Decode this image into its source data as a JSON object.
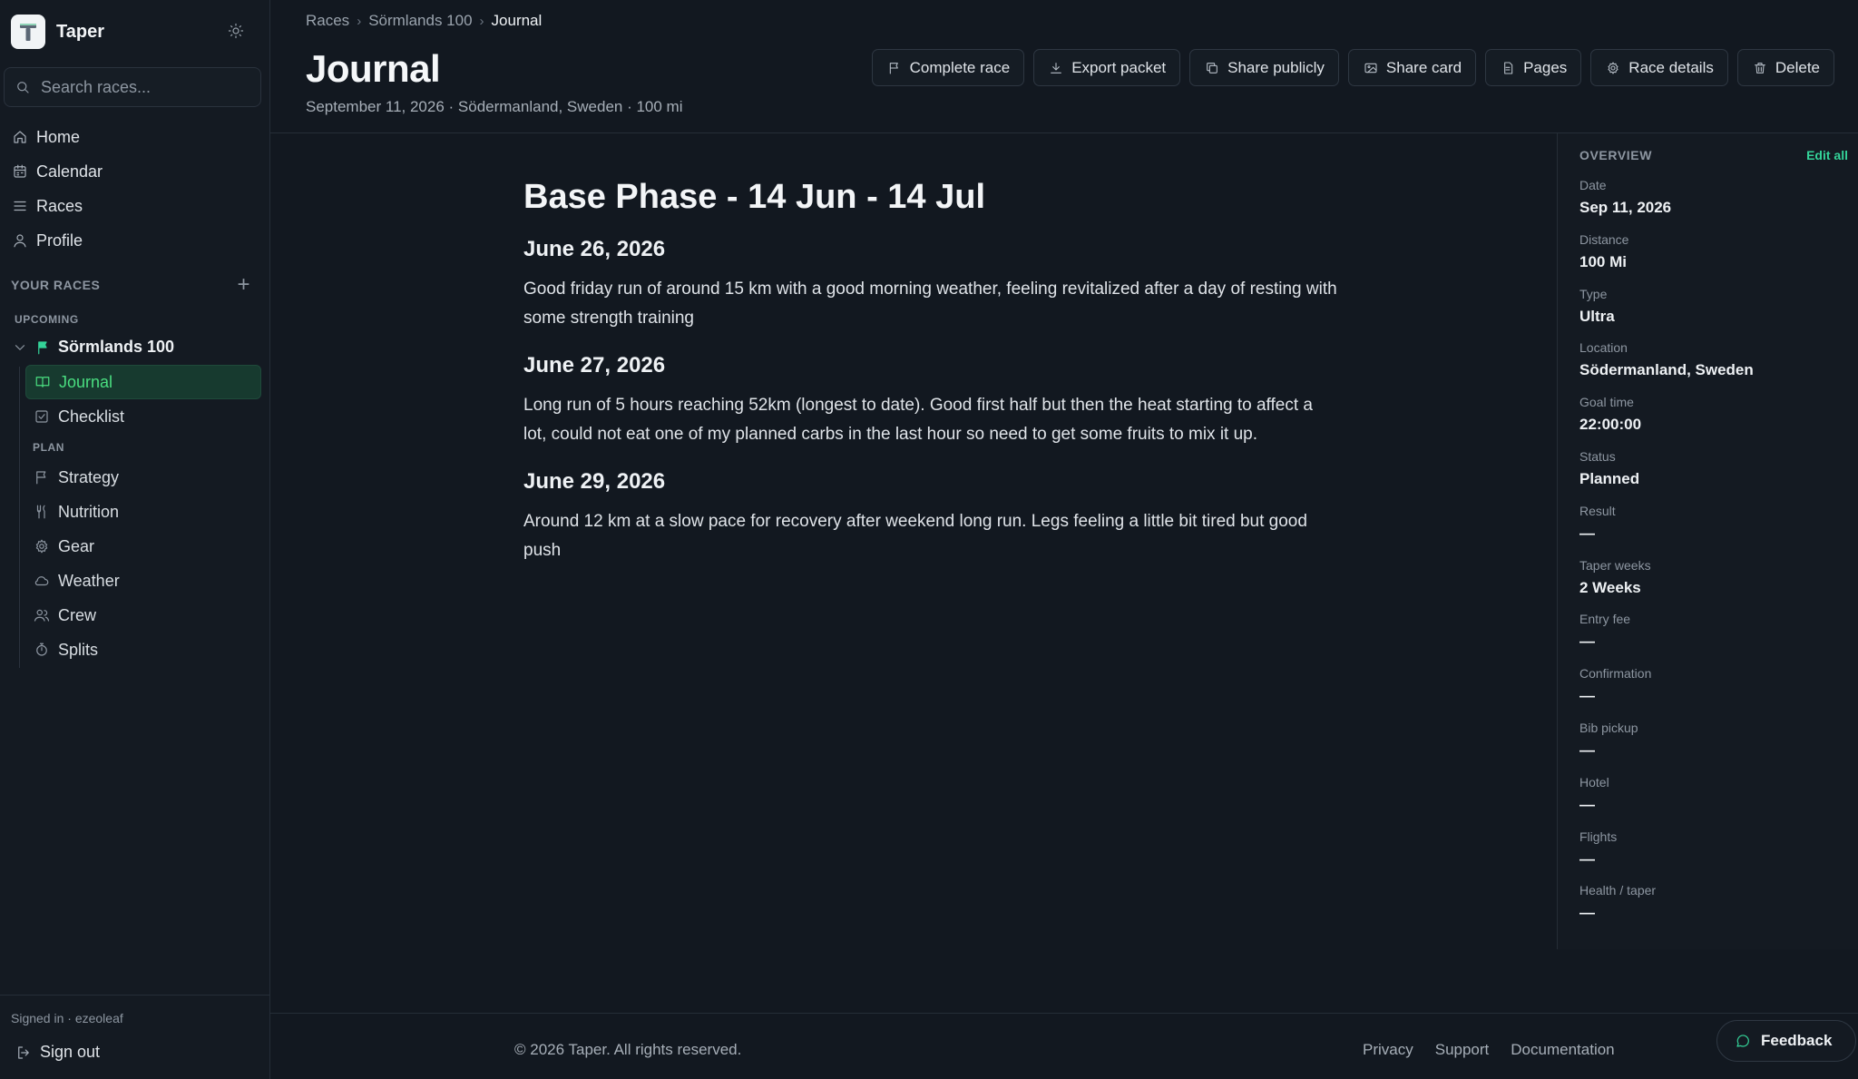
{
  "app": {
    "name": "Taper"
  },
  "sidebar": {
    "search_placeholder": "Search races...",
    "nav": [
      {
        "label": "Home",
        "icon": "home-icon"
      },
      {
        "label": "Calendar",
        "icon": "calendar-icon"
      },
      {
        "label": "Races",
        "icon": "list-icon"
      },
      {
        "label": "Profile",
        "icon": "user-icon"
      }
    ],
    "your_races_label": "YOUR RACES",
    "upcoming_label": "UPCOMING",
    "race_name": "Sörmlands 100",
    "race_pages": [
      {
        "label": "Journal",
        "icon": "book-icon",
        "active": true
      },
      {
        "label": "Checklist",
        "icon": "checkbox-icon"
      }
    ],
    "plan_label": "PLAN",
    "plan_pages": [
      {
        "label": "Strategy",
        "icon": "flag-icon"
      },
      {
        "label": "Nutrition",
        "icon": "utensils-icon"
      },
      {
        "label": "Gear",
        "icon": "gear-icon"
      },
      {
        "label": "Weather",
        "icon": "cloud-icon"
      },
      {
        "label": "Crew",
        "icon": "users-icon"
      },
      {
        "label": "Splits",
        "icon": "stopwatch-icon"
      }
    ],
    "signed_in": "Signed in · ezeoleaf",
    "sign_out": "Sign out"
  },
  "breadcrumb": [
    "Races",
    "Sörmlands 100",
    "Journal"
  ],
  "page": {
    "title": "Journal",
    "subtitle": "September 11, 2026 · Södermanland, Sweden · 100 mi"
  },
  "actions": [
    {
      "label": "Complete race",
      "icon": "flag-icon"
    },
    {
      "label": "Export packet",
      "icon": "download-icon"
    },
    {
      "label": "Share publicly",
      "icon": "copy-icon"
    },
    {
      "label": "Share card",
      "icon": "image-icon"
    },
    {
      "label": "Pages",
      "icon": "pages-icon"
    },
    {
      "label": "Race details",
      "icon": "gear-icon"
    },
    {
      "label": "Delete",
      "icon": "trash-icon"
    }
  ],
  "journal": {
    "phase_title": "Base Phase - 14 Jun - 14 Jul",
    "entries": [
      {
        "date": "June 26, 2026",
        "text": "Good friday run of around 15 km with a good morning weather, feeling revitalized after a day of resting with some strength training"
      },
      {
        "date": "June 27, 2026",
        "text": "Long run of 5 hours reaching 52km (longest to date). Good first half but then the heat starting to affect a lot, could not eat one of my planned carbs in the last hour so need to get some fruits to mix it up."
      },
      {
        "date": "June 29, 2026",
        "text": "Around 12 km at a slow pace for recovery after weekend long run. Legs feeling a little bit tired but good push"
      }
    ]
  },
  "overview": {
    "label": "OVERVIEW",
    "edit_all": "Edit all",
    "fields": [
      {
        "key": "Date",
        "value": "Sep 11, 2026"
      },
      {
        "key": "Distance",
        "value": "100 Mi"
      },
      {
        "key": "Type",
        "value": "Ultra"
      },
      {
        "key": "Location",
        "value": "Södermanland, Sweden"
      },
      {
        "key": "Goal time",
        "value": "22:00:00"
      },
      {
        "key": "Status",
        "value": "Planned"
      },
      {
        "key": "Result",
        "value": "—"
      },
      {
        "key": "Taper weeks",
        "value": "2 Weeks"
      },
      {
        "key": "Entry fee",
        "value": "—"
      },
      {
        "key": "Confirmation",
        "value": "—"
      },
      {
        "key": "Bib pickup",
        "value": "—"
      },
      {
        "key": "Hotel",
        "value": "—"
      },
      {
        "key": "Flights",
        "value": "—"
      },
      {
        "key": "Health / taper",
        "value": "—"
      }
    ]
  },
  "footer": {
    "copyright": "© 2026 Taper. All rights reserved.",
    "links": [
      "Privacy",
      "Support",
      "Documentation"
    ],
    "feedback": "Feedback"
  },
  "colors": {
    "accent": "#34d399",
    "background": "#121820",
    "active_bg": "#173a2f"
  }
}
